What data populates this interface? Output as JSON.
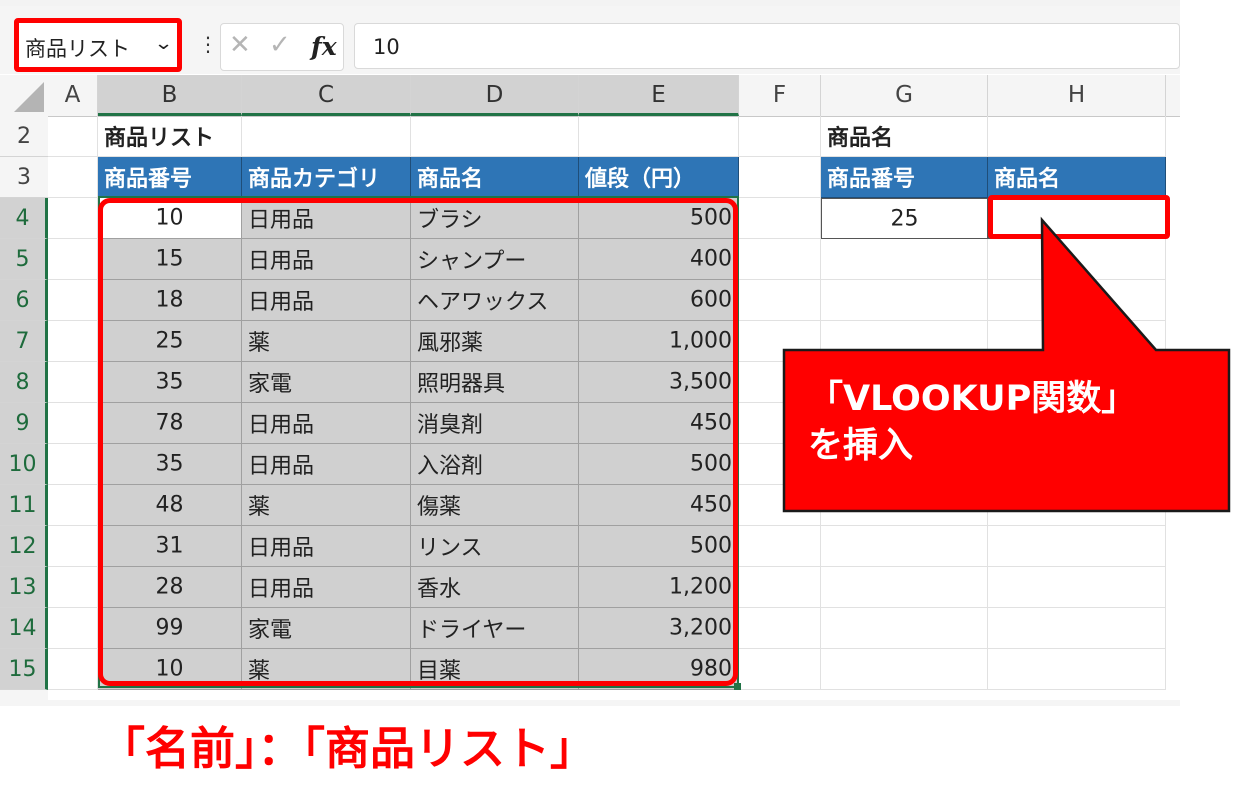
{
  "formula_bar": {
    "name_box_value": "商品リスト",
    "cancel_icon": "✕",
    "enter_icon": "✓",
    "fx_label": "fx",
    "formula_value": "10"
  },
  "columns": [
    "A",
    "B",
    "C",
    "D",
    "E",
    "F",
    "G",
    "H"
  ],
  "rows": [
    "2",
    "3",
    "4",
    "5",
    "6",
    "7",
    "8",
    "9",
    "10",
    "11",
    "12",
    "13",
    "14",
    "15"
  ],
  "table": {
    "title": "商品リスト",
    "headers": [
      "商品番号",
      "商品カテゴリ",
      "商品名",
      "値段（円）"
    ],
    "rows": [
      [
        "10",
        "日用品",
        "ブラシ",
        "500"
      ],
      [
        "15",
        "日用品",
        "シャンプー",
        "400"
      ],
      [
        "18",
        "日用品",
        "ヘアワックス",
        "600"
      ],
      [
        "25",
        "薬",
        "風邪薬",
        "1,000"
      ],
      [
        "35",
        "家電",
        "照明器具",
        "3,500"
      ],
      [
        "78",
        "日用品",
        "消臭剤",
        "450"
      ],
      [
        "35",
        "日用品",
        "入浴剤",
        "500"
      ],
      [
        "48",
        "薬",
        "傷薬",
        "450"
      ],
      [
        "31",
        "日用品",
        "リンス",
        "500"
      ],
      [
        "28",
        "日用品",
        "香水",
        "1,200"
      ],
      [
        "99",
        "家電",
        "ドライヤー",
        "3,200"
      ],
      [
        "10",
        "薬",
        "目薬",
        "980"
      ]
    ]
  },
  "lookup": {
    "title": "商品名",
    "headers": [
      "商品番号",
      "商品名"
    ],
    "value": "25",
    "result": ""
  },
  "annotations": {
    "callout": "「VLOOKUP関数」\nを挿入",
    "caption": "「名前」：「商品リスト」"
  },
  "colors": {
    "highlight_red": "#ff0000",
    "header_blue": "#2e75b6",
    "selection_grey": "#d0d0d0",
    "excel_green": "#217346"
  }
}
